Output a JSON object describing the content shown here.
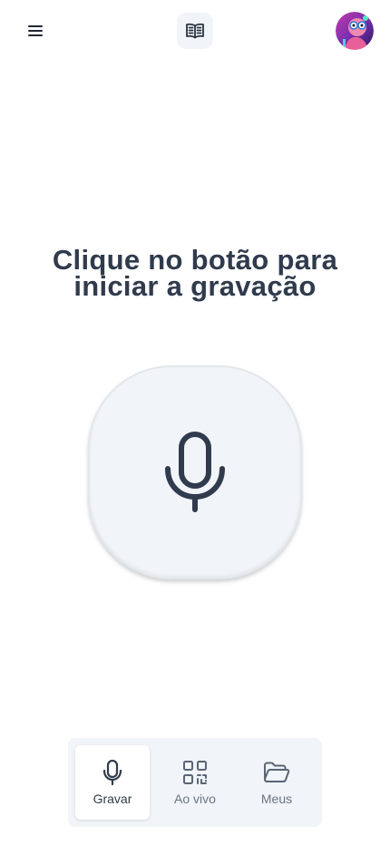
{
  "header": {
    "menu_icon": "hamburger-menu-icon",
    "logo_icon": "open-book-icon",
    "avatar_icon": "user-avatar"
  },
  "main": {
    "headline_line1": "Clique no botão para",
    "headline_line2": "iniciar a gravação",
    "record_icon": "microphone-icon"
  },
  "bottom_nav": {
    "tabs": [
      {
        "label": "Gravar",
        "icon": "microphone-icon",
        "active": true
      },
      {
        "label": "Ao vivo",
        "icon": "qr-code-icon",
        "active": false
      },
      {
        "label": "Meus",
        "icon": "folder-open-icon",
        "active": false
      }
    ]
  },
  "colors": {
    "text_primary": "#303b4d",
    "text_secondary": "#6b7585",
    "surface": "#f1f4f8",
    "background": "#ffffff"
  }
}
